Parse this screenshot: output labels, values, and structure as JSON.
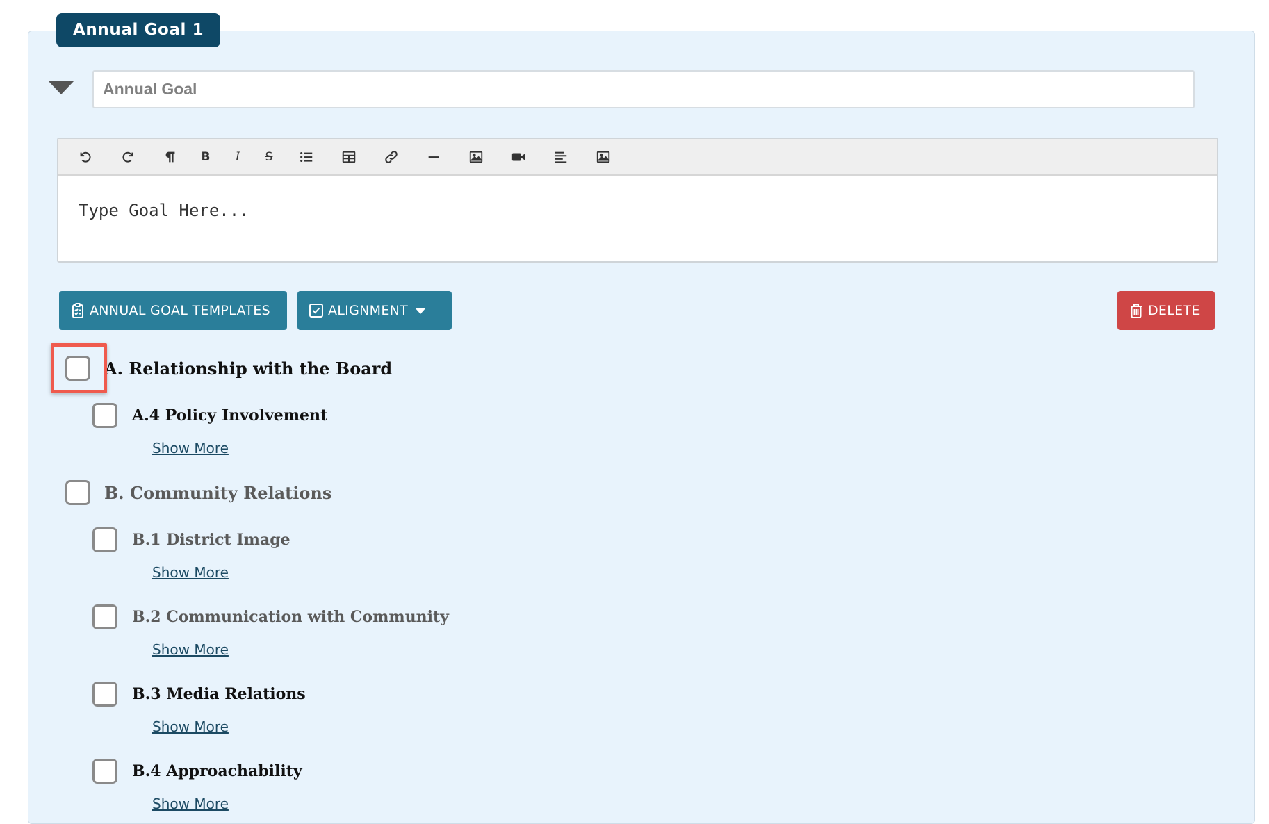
{
  "goal": {
    "tab_label": "Annual Goal 1",
    "title_placeholder": "Annual Goal",
    "title_value": "",
    "editor_placeholder": "Type Goal Here..."
  },
  "toolbar": [
    {
      "icon": "undo-icon"
    },
    {
      "icon": "redo-icon"
    },
    {
      "icon": "paragraph-icon"
    },
    {
      "icon": "bold-icon",
      "glyph": "B"
    },
    {
      "icon": "italic-icon",
      "glyph": "I"
    },
    {
      "icon": "strikethrough-icon",
      "glyph": "S"
    },
    {
      "icon": "bulleted-list-icon"
    },
    {
      "icon": "table-icon"
    },
    {
      "icon": "link-icon"
    },
    {
      "icon": "horizontal-rule-icon"
    },
    {
      "icon": "image-icon"
    },
    {
      "icon": "video-icon"
    },
    {
      "icon": "align-left-icon"
    },
    {
      "icon": "image-icon"
    }
  ],
  "buttons": {
    "templates": {
      "label": "ANNUAL GOAL TEMPLATES",
      "icon": "clipboard-list-icon"
    },
    "alignment": {
      "label": "ALIGNMENT",
      "icon": "checkbox-icon"
    },
    "delete": {
      "label": "DELETE",
      "icon": "trash-icon"
    }
  },
  "alignment_items": [
    {
      "label": "A. Relationship with the Board",
      "level": "category",
      "checked": false
    },
    {
      "label": "A.4 Policy Involvement",
      "level": "standard",
      "checked": false,
      "show_more": "Show More"
    },
    {
      "label": "B. Community Relations",
      "level": "category",
      "checked": false
    },
    {
      "label": "B.1 District Image",
      "level": "standard",
      "checked": false,
      "show_more": "Show More"
    },
    {
      "label": "B.2 Communication with Community",
      "level": "standard",
      "checked": false,
      "show_more": "Show More"
    },
    {
      "label": "B.3 Media Relations",
      "level": "standard",
      "checked": false,
      "show_more": "Show More"
    },
    {
      "label": "B.4 Approachability",
      "level": "standard",
      "checked": false,
      "show_more": "Show More"
    }
  ],
  "colors": {
    "panel_bg": "#e8f3fc",
    "tab_bg": "#0e4866",
    "button_teal": "#2a7e9a",
    "button_red": "#cf4646",
    "highlight": "#ef5a4d"
  }
}
